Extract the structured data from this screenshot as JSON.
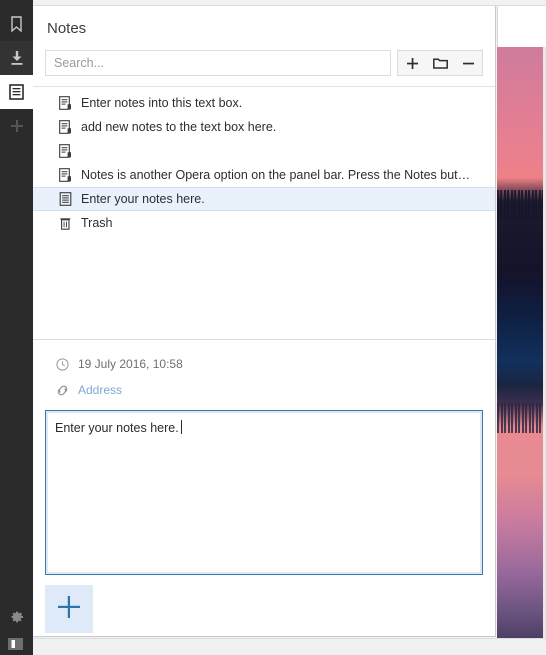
{
  "sidebar": {
    "items": [
      {
        "name": "bookmarks",
        "icon": "bookmark-icon",
        "state": "normal"
      },
      {
        "name": "downloads",
        "icon": "download-icon",
        "state": "dim"
      },
      {
        "name": "notes",
        "icon": "notes-icon",
        "state": "active"
      },
      {
        "name": "add-panel",
        "icon": "plus-icon",
        "state": "normal"
      }
    ],
    "settings": {
      "name": "settings",
      "icon": "gear-icon"
    },
    "toggle": {
      "name": "panel-toggle",
      "icon": "panel-toggle-icon"
    }
  },
  "panel": {
    "title": "Notes",
    "search": {
      "value": "",
      "placeholder": "Search..."
    },
    "buttons": [
      {
        "name": "new-note",
        "icon": "plus-icon",
        "label": "+"
      },
      {
        "name": "new-folder",
        "icon": "folder-icon",
        "label": "Folder"
      },
      {
        "name": "delete-note",
        "icon": "minus-icon",
        "label": "−"
      }
    ],
    "list": [
      {
        "icon": "note-bookmark-icon",
        "label": "Enter notes into this text box.",
        "selected": false
      },
      {
        "icon": "note-bookmark-icon",
        "label": "add new notes to the text box here.",
        "selected": false
      },
      {
        "icon": "note-bookmark-icon",
        "label": "",
        "selected": false
      },
      {
        "icon": "note-bookmark-icon",
        "label": "Notes is another Opera option on the panel bar. Press the Notes but…",
        "selected": false
      },
      {
        "icon": "note-document-icon",
        "label": "Enter your notes here.",
        "selected": true
      },
      {
        "icon": "trash-icon",
        "label": "Trash",
        "selected": false
      }
    ],
    "detail": {
      "date": "19 July 2016, 10:58",
      "date_icon": "clock-icon",
      "address_label": "Address",
      "address_icon": "link-icon",
      "note_text": "Enter your notes here.",
      "add_button": {
        "name": "add-note-button",
        "icon": "plus-icon"
      }
    }
  },
  "colors": {
    "accent": "#3a78ab",
    "selection_bg": "#e9f2fb",
    "sidebar_bg": "#2b2b2b",
    "add_button_bg": "#dfeaf8",
    "link": "#7fa8d4"
  }
}
